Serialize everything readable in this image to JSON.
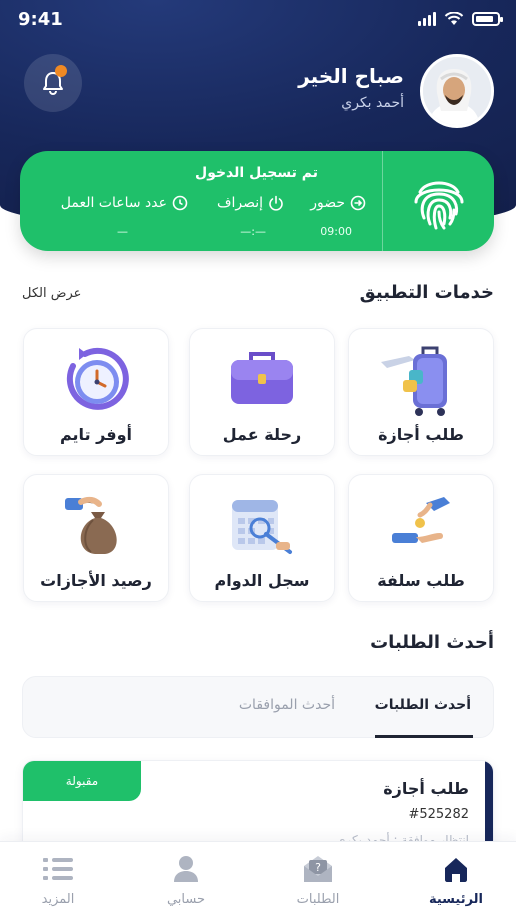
{
  "status": {
    "time": "9:41",
    "battery_level": 0.85
  },
  "header": {
    "greeting": "صباح الخير",
    "user_name": "أحمد بكري"
  },
  "attendance": {
    "title": "تم تسجيل الدخول",
    "check_in_label": "حضور",
    "check_in_value": "09:00",
    "check_out_label": "إنصراف",
    "check_out_value": "—:—",
    "hours_label": "عدد ساعات العمل",
    "hours_value": "—"
  },
  "services": {
    "title": "خدمات التطبيق",
    "view_all": "عرض الكل",
    "items": [
      {
        "label": "طلب أجازة",
        "icon": "suitcase-travel-icon"
      },
      {
        "label": "رحلة عمل",
        "icon": "briefcase-icon"
      },
      {
        "label": "أوفر تايم",
        "icon": "clock-icon"
      },
      {
        "label": "طلب سلفة",
        "icon": "money-hand-icon"
      },
      {
        "label": "سجل الدوام",
        "icon": "calendar-icon"
      },
      {
        "label": "رصيد الأجازات",
        "icon": "money-bag-icon"
      }
    ]
  },
  "requests": {
    "title": "أحدث الطلبات",
    "tab_latest": "أحدث الطلبات",
    "tab_approvals": "أحدث الموافقات",
    "card": {
      "title": "طلب أجازة",
      "id": "#525282",
      "subtitle": "انتظار موافقة : أحمد بكري",
      "status": "مقبولة"
    }
  },
  "nav": {
    "home": "الرئيسية",
    "requests": "الطلبات",
    "account": "حسابي",
    "more": "المزيد"
  },
  "colors": {
    "primary": "#17275a",
    "accent_green": "#1fc06a",
    "notification": "#f08a24"
  }
}
